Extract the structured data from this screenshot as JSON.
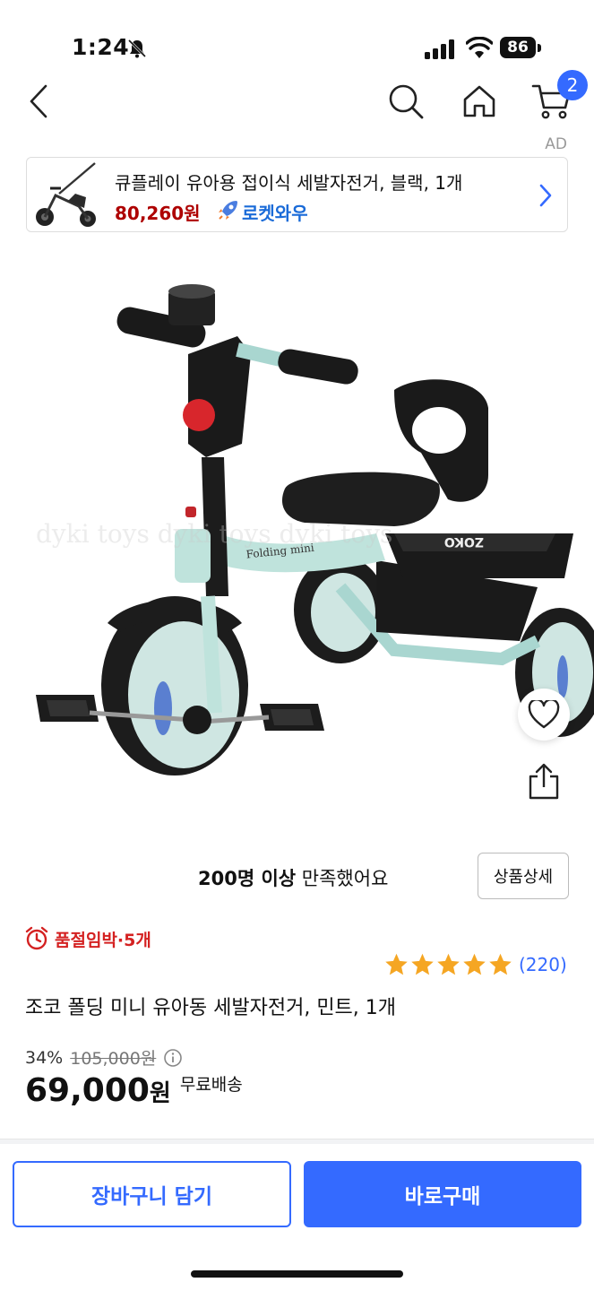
{
  "status_bar": {
    "time": "1:24",
    "battery": "86"
  },
  "nav": {
    "cart_count": "2"
  },
  "ad": {
    "label": "AD",
    "title": "큐플레이 유아용 접이식 세발자전거, 블랙, 1개",
    "price": "80,260원",
    "delivery_badge": "로켓와우"
  },
  "product_image": {
    "watermark": "dyki toys dyki toys dyki toys"
  },
  "satisfaction": {
    "count": "200명 이상",
    "text": " 만족했어요"
  },
  "detail_button": "상품상세",
  "stock_alert": "품절임박·5개",
  "rating": {
    "stars": 5,
    "review_count": "(220)"
  },
  "product_name": "조코 폴딩 미니 유아동 세발자전거, 민트, 1개",
  "pricing": {
    "discount": "34%",
    "original_price": "105,000원",
    "price": "69,000",
    "price_unit": "원",
    "shipping": "무료배송"
  },
  "actions": {
    "add_to_cart": "장바구니 담기",
    "buy_now": "바로구매"
  },
  "colors": {
    "accent": "#346aff",
    "alert": "#d42121",
    "ad_price": "#ae0000",
    "star": "#f5a623"
  }
}
